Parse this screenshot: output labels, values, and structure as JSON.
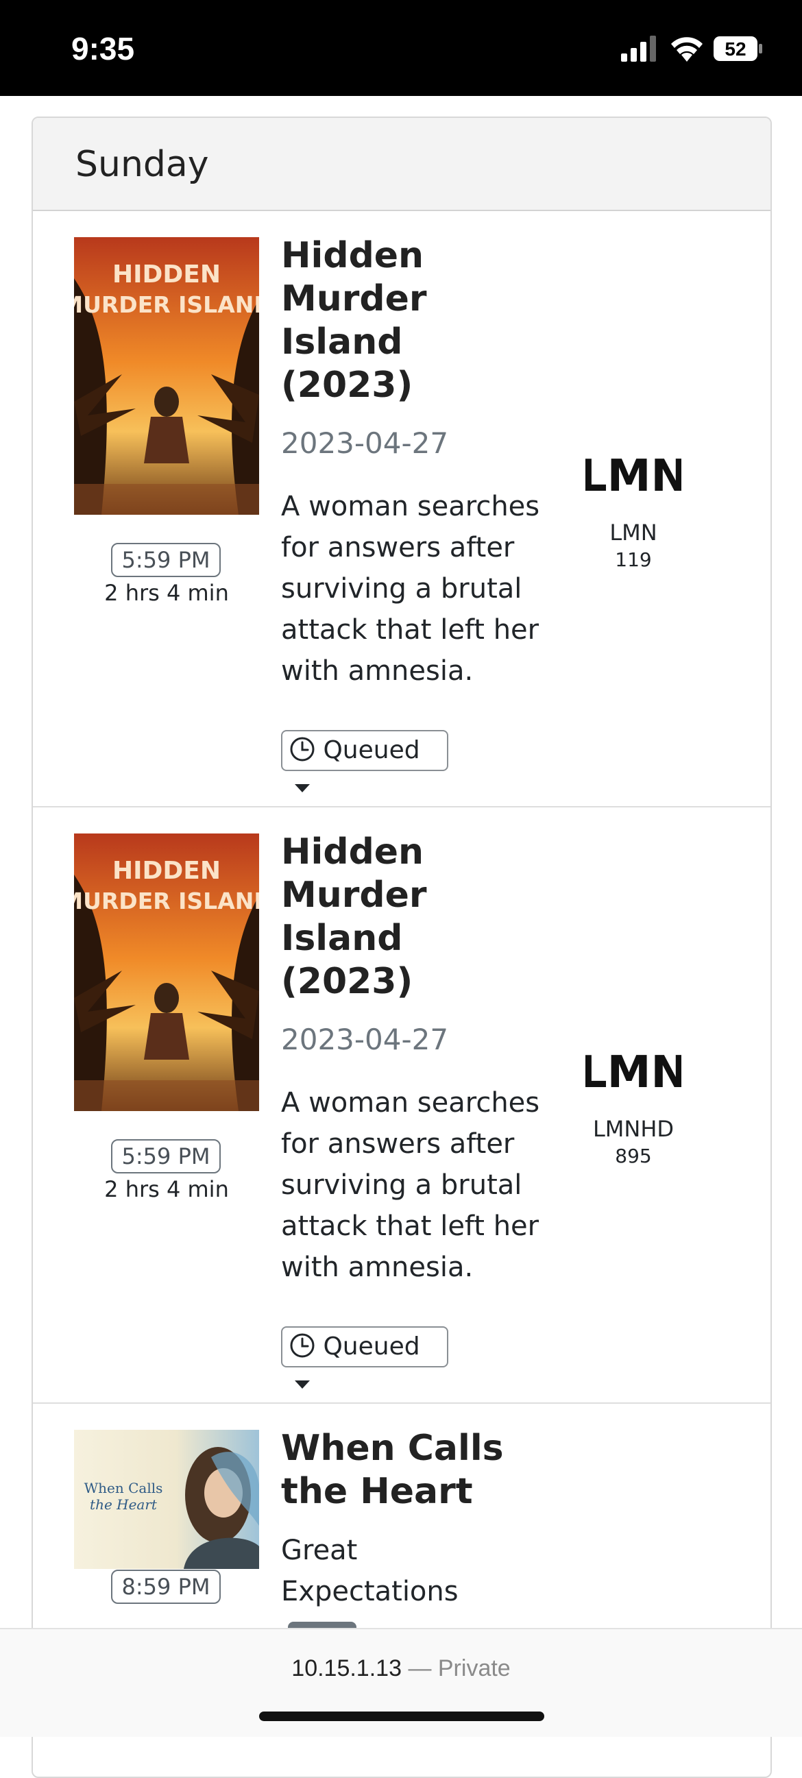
{
  "status_bar": {
    "time": "9:35",
    "battery": "52"
  },
  "day_header": "Sunday",
  "listings": [
    {
      "title": "Hidden Murder Island (2023)",
      "poster_text_line1": "HIDDEN",
      "poster_text_line2": "MURDER ISLAND",
      "date": "2023-04-27",
      "description": "A woman searches for answers after surviving a brutal attack that left her with amnesia.",
      "time": "5:59 PM",
      "duration": "2 hrs 4 min",
      "status": "Queued",
      "channel_name": "LMN",
      "channel_number": "119",
      "channel_logo": "LMN"
    },
    {
      "title": "Hidden Murder Island (2023)",
      "poster_text_line1": "HIDDEN",
      "poster_text_line2": "MURDER ISLAND",
      "date": "2023-04-27",
      "description": "A woman searches for answers after surviving a brutal attack that left her with amnesia.",
      "time": "5:59 PM",
      "duration": "2 hrs 4 min",
      "status": "Queued",
      "channel_name": "LMNHD",
      "channel_number": "895",
      "channel_logo": "LMN"
    },
    {
      "title": "When Calls the Heart",
      "poster_text_line1": "When Calls",
      "poster_text_line2": "the Heart",
      "subtitle": "Great Expectations",
      "time": "8:59 PM"
    }
  ],
  "address_bar": {
    "host": "10.15.1.13",
    "mode": "— Private"
  },
  "colors": {
    "status_bar": "#000000",
    "header_bg": "#f3f3f3",
    "muted_text": "#6c757d",
    "border": "#d8d8d8"
  }
}
